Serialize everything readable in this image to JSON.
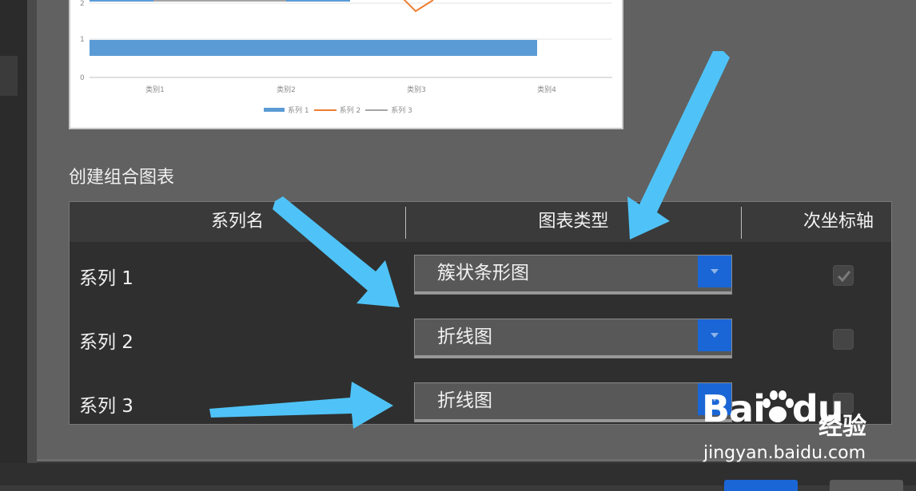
{
  "preview_chart": {
    "legend": [
      "系列 1",
      "系列 2",
      "系列 3"
    ]
  },
  "chart_data": {
    "type": "bar",
    "categories": [
      "类别1",
      "类别2",
      "类别3",
      "类别4"
    ],
    "y_ticks": [
      "0",
      "1",
      "2"
    ],
    "series": [
      {
        "name": "系列 1",
        "type": "bar"
      },
      {
        "name": "系列 2",
        "type": "line"
      },
      {
        "name": "系列 3",
        "type": "line"
      }
    ],
    "colors": {
      "系列 1": "#5b9bd5",
      "系列 2": "#ed7d31",
      "系列 3": "#a5a5a5"
    }
  },
  "section": {
    "title": "创建组合图表"
  },
  "table": {
    "headers": {
      "series_name": "系列名",
      "chart_type": "图表类型",
      "secondary_axis": "次坐标轴"
    },
    "rows": [
      {
        "name": "系列 1",
        "chart_type": "簇状条形图",
        "secondary_axis_checked": true
      },
      {
        "name": "系列 2",
        "chart_type": "折线图",
        "secondary_axis_checked": false
      },
      {
        "name": "系列 3",
        "chart_type": "折线图",
        "secondary_axis_checked": false
      }
    ]
  },
  "watermark": {
    "logo": "Bai",
    "logo_tail": "du",
    "brand": "经验",
    "url": "jingyan.baidu.com"
  },
  "colors": {
    "accent": "#1a66d6",
    "arrow": "#4fc3f7"
  }
}
